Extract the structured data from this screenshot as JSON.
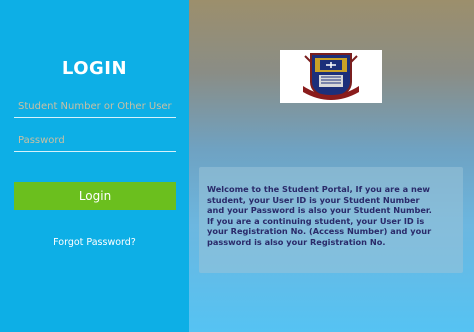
{
  "login": {
    "title": "LOGIN",
    "username_placeholder": "Student Number or Other User",
    "password_placeholder": "Password",
    "submit_label": "Login",
    "forgot_label": "Forgot Password?"
  },
  "welcome": {
    "text": "Welcome to the Student Portal, If you are a new student, your User ID is your Student Number and your Password is also your Student Number. If you are a continuing student, your User ID is your Registration No. (Access Number) and your password is also your Registration No."
  },
  "colors": {
    "panel": "#0dafe6",
    "button": "#6bbf1e",
    "info_text": "#2a2a6a"
  },
  "logo": {
    "icon": "university-crest-logo"
  }
}
